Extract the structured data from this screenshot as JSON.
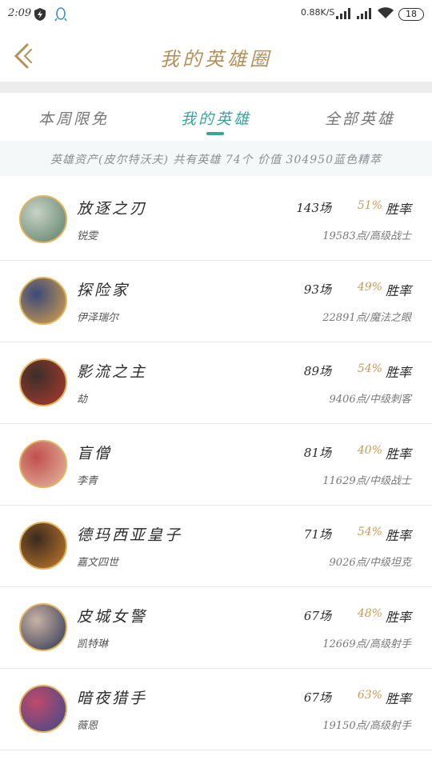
{
  "status_bar": {
    "time": "2:09",
    "net_speed": "0.88K/S",
    "battery": "18"
  },
  "header": {
    "title": "我的英雄圈"
  },
  "tabs": [
    {
      "label": "本周限免"
    },
    {
      "label": "我的英雄"
    },
    {
      "label": "全部英雄"
    }
  ],
  "assets_bar": {
    "text": "英雄资产(皮尔特沃夫)  共有英雄 74个   价值 304950蓝色精萃"
  },
  "heroes": [
    {
      "title": "放逐之刃",
      "name": "锐雯",
      "games": "143场",
      "winrate": "51%",
      "winlabel": "胜率",
      "points": "19583点/高级战士",
      "colors": [
        "#5a7d6a",
        "#c9d3c4"
      ]
    },
    {
      "title": "探险家",
      "name": "伊泽瑞尔",
      "games": "93场",
      "winrate": "49%",
      "winlabel": "胜率",
      "points": "22891点/魔法之眼",
      "colors": [
        "#d9a24a",
        "#3a4a7a"
      ]
    },
    {
      "title": "影流之主",
      "name": "劫",
      "games": "89场",
      "winrate": "54%",
      "winlabel": "胜率",
      "points": "9406点/中级刺客",
      "colors": [
        "#b03a2e",
        "#3b2f2a"
      ]
    },
    {
      "title": "盲僧",
      "name": "李青",
      "games": "81场",
      "winrate": "40%",
      "winlabel": "胜率",
      "points": "11629点/中级战士",
      "colors": [
        "#e6b8a0",
        "#c0504d"
      ]
    },
    {
      "title": "德玛西亚皇子",
      "name": "嘉文四世",
      "games": "71场",
      "winrate": "54%",
      "winlabel": "胜率",
      "points": "9026点/中级坦克",
      "colors": [
        "#c67a2c",
        "#3a2a1e"
      ]
    },
    {
      "title": "皮城女警",
      "name": "凯特琳",
      "games": "67场",
      "winrate": "48%",
      "winlabel": "胜率",
      "points": "12669点/高级射手",
      "colors": [
        "#2d3550",
        "#c8b2a6"
      ]
    },
    {
      "title": "暗夜猎手",
      "name": "薇恩",
      "games": "67场",
      "winrate": "63%",
      "winlabel": "胜率",
      "points": "19150点/高级射手",
      "colors": [
        "#3b4a8c",
        "#c04a6a"
      ]
    }
  ]
}
